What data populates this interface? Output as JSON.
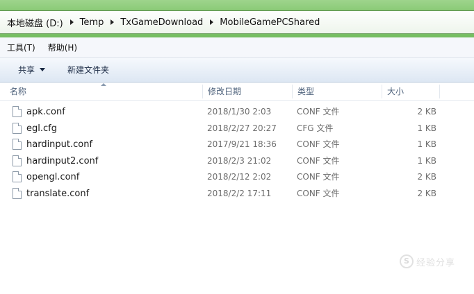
{
  "address": {
    "crumbs": [
      "本地磁盘 (D:)",
      "Temp",
      "TxGameDownload",
      "MobileGamePCShared"
    ]
  },
  "menu": {
    "items": [
      "工具(T)",
      "帮助(H)"
    ]
  },
  "commands": {
    "share": "共享",
    "new_folder": "新建文件夹"
  },
  "columns": {
    "name": "名称",
    "date": "修改日期",
    "type": "类型",
    "size": "大小"
  },
  "files": [
    {
      "name": "apk.conf",
      "date": "2018/1/30 2:03",
      "type": "CONF 文件",
      "size": "2 KB"
    },
    {
      "name": "egl.cfg",
      "date": "2018/2/27 20:27",
      "type": "CFG 文件",
      "size": "1 KB"
    },
    {
      "name": "hardinput.conf",
      "date": "2017/9/21 18:36",
      "type": "CONF 文件",
      "size": "1 KB"
    },
    {
      "name": "hardinput2.conf",
      "date": "2018/2/3 21:02",
      "type": "CONF 文件",
      "size": "1 KB"
    },
    {
      "name": "opengl.conf",
      "date": "2018/2/12 2:02",
      "type": "CONF 文件",
      "size": "2 KB"
    },
    {
      "name": "translate.conf",
      "date": "2018/2/2 17:11",
      "type": "CONF 文件",
      "size": "2 KB"
    }
  ],
  "watermark": {
    "glyph": "S",
    "text": "经验分享"
  },
  "icons": {
    "file": "file-icon",
    "separator": "chevron-right-icon",
    "dropdown": "chevron-down-icon"
  },
  "colors": {
    "address_glass": "#7ec46a",
    "command_bar": "#dde7f3",
    "header_text": "#4c607a"
  }
}
